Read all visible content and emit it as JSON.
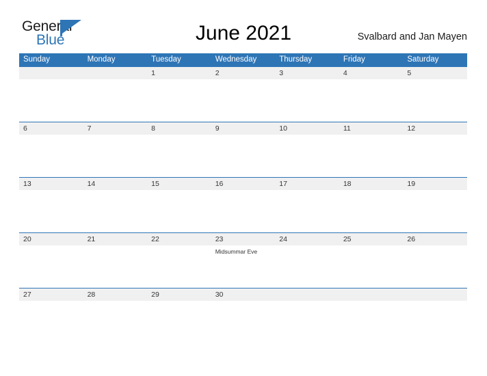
{
  "brand": {
    "name_part1": "General",
    "name_part2": "Blue",
    "flag_icon": "pennant-flag-icon",
    "accent_color": "#2e75b6"
  },
  "header": {
    "title": "June 2021",
    "subtitle": "Svalbard and Jan Mayen"
  },
  "calendar": {
    "month": "June",
    "year": "2021",
    "header_bg_color": "#2e75b6",
    "date_band_color": "#f0f0f0",
    "weekdays": [
      "Sunday",
      "Monday",
      "Tuesday",
      "Wednesday",
      "Thursday",
      "Friday",
      "Saturday"
    ],
    "weeks": [
      {
        "days": [
          {
            "date": "",
            "events": []
          },
          {
            "date": "",
            "events": []
          },
          {
            "date": "1",
            "events": []
          },
          {
            "date": "2",
            "events": []
          },
          {
            "date": "3",
            "events": []
          },
          {
            "date": "4",
            "events": []
          },
          {
            "date": "5",
            "events": []
          }
        ]
      },
      {
        "days": [
          {
            "date": "6",
            "events": []
          },
          {
            "date": "7",
            "events": []
          },
          {
            "date": "8",
            "events": []
          },
          {
            "date": "9",
            "events": []
          },
          {
            "date": "10",
            "events": []
          },
          {
            "date": "11",
            "events": []
          },
          {
            "date": "12",
            "events": []
          }
        ]
      },
      {
        "days": [
          {
            "date": "13",
            "events": []
          },
          {
            "date": "14",
            "events": []
          },
          {
            "date": "15",
            "events": []
          },
          {
            "date": "16",
            "events": []
          },
          {
            "date": "17",
            "events": []
          },
          {
            "date": "18",
            "events": []
          },
          {
            "date": "19",
            "events": []
          }
        ]
      },
      {
        "days": [
          {
            "date": "20",
            "events": []
          },
          {
            "date": "21",
            "events": []
          },
          {
            "date": "22",
            "events": []
          },
          {
            "date": "23",
            "events": [
              "Midsummar Eve"
            ]
          },
          {
            "date": "24",
            "events": []
          },
          {
            "date": "25",
            "events": []
          },
          {
            "date": "26",
            "events": []
          }
        ]
      },
      {
        "days": [
          {
            "date": "27",
            "events": []
          },
          {
            "date": "28",
            "events": []
          },
          {
            "date": "29",
            "events": []
          },
          {
            "date": "30",
            "events": []
          },
          {
            "date": "",
            "events": []
          },
          {
            "date": "",
            "events": []
          },
          {
            "date": "",
            "events": []
          }
        ]
      }
    ]
  }
}
